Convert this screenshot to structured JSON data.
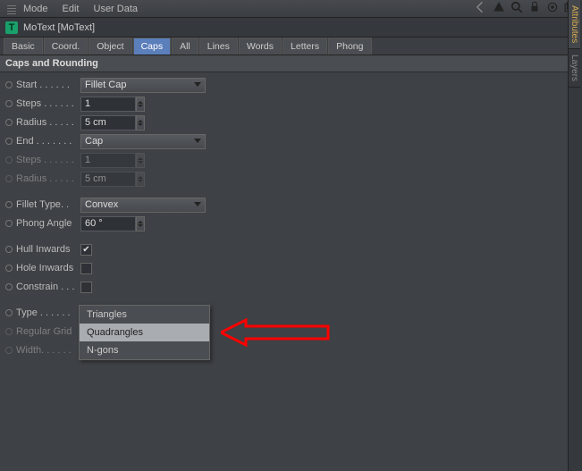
{
  "menu": {
    "mode": "Mode",
    "edit": "Edit",
    "userdata": "User Data"
  },
  "header": {
    "title": "MoText [MoText]"
  },
  "tabs": [
    "Basic",
    "Coord.",
    "Object",
    "Caps",
    "All",
    "Lines",
    "Words",
    "Letters",
    "Phong"
  ],
  "active_tab": "Caps",
  "group": "Caps and Rounding",
  "rows": {
    "start": {
      "label": "Start",
      "value": "Fillet Cap"
    },
    "steps1": {
      "label": "Steps",
      "value": "1"
    },
    "radius1": {
      "label": "Radius",
      "value": "5 cm"
    },
    "end": {
      "label": "End",
      "value": "Cap"
    },
    "steps2": {
      "label": "Steps",
      "value": "1"
    },
    "radius2": {
      "label": "Radius",
      "value": "5 cm"
    },
    "fillet": {
      "label": "Fillet Type",
      "value": "Convex"
    },
    "phong": {
      "label": "Phong Angle",
      "value": "60 °"
    },
    "hull": {
      "label": "Hull Inwards",
      "checked": true
    },
    "hole": {
      "label": "Hole Inwards",
      "checked": false
    },
    "constrain": {
      "label": "Constrain",
      "checked": false
    },
    "type": {
      "label": "Type",
      "value": "Quadrangles"
    },
    "regular": {
      "label": "Regular Grid",
      "checked": false
    },
    "width": {
      "label": "Width",
      "value": ""
    }
  },
  "dropdown": {
    "options": [
      "Triangles",
      "Quadrangles",
      "N-gons"
    ],
    "selected": "Quadrangles"
  },
  "sidetabs": {
    "attributes": "Attributes",
    "layers": "Layers"
  }
}
